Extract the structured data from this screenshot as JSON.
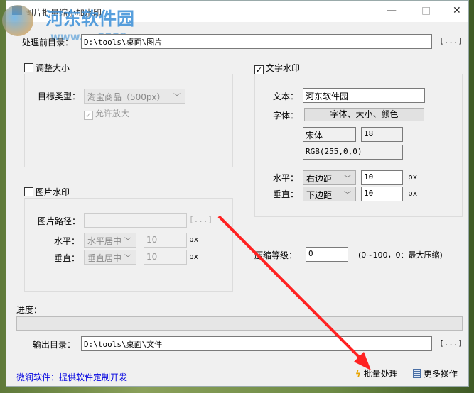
{
  "window": {
    "title": "图片批量缩小加水印",
    "minimize": "—",
    "maximize": "□",
    "close": "✕"
  },
  "watermark": {
    "name": "河东软件园",
    "url": "www.pc0359.cn"
  },
  "source": {
    "label": "处理前目录：",
    "value": "D:\\tools\\桌面\\图片",
    "browse": "[...]"
  },
  "resize": {
    "label": "调整大小",
    "checked": false,
    "type_label": "目标类型：",
    "type_value": "淘宝商品（500px）",
    "allow_enlarge": "允许放大",
    "allow_enlarge_checked": true
  },
  "image_wm": {
    "label": "图片水印",
    "checked": false,
    "path_label": "图片路径：",
    "path_value": "",
    "browse": "[...]",
    "h_label": "水平：",
    "h_value": "水平居中",
    "h_offset": "10",
    "v_label": "垂直：",
    "v_value": "垂直居中",
    "v_offset": "10",
    "unit": "px"
  },
  "text_wm": {
    "label": "文字水印",
    "checked": true,
    "text_label": "文本：",
    "text_value": "河东软件园",
    "font_label": "字体：",
    "font_button": "字体、大小、颜色",
    "font_name": "宋体",
    "font_size": "18",
    "color": "RGB(255,0,0)",
    "h_label": "水平：",
    "h_value": "右边距",
    "h_offset": "10",
    "v_label": "垂直：",
    "v_value": "下边距",
    "v_offset": "10",
    "unit": "px"
  },
  "compress": {
    "label": "压缩等级：",
    "value": "0",
    "hint": "(0~100，0：最大压缩)"
  },
  "progress": {
    "label": "进度：",
    "percent": 0
  },
  "output": {
    "label": "输出目录：",
    "value": "D:\\tools\\桌面\\文件",
    "browse": "[...]"
  },
  "footer": {
    "link": "微润软件：提供软件定制开发",
    "batch": "批量处理",
    "more": "更多操作"
  }
}
